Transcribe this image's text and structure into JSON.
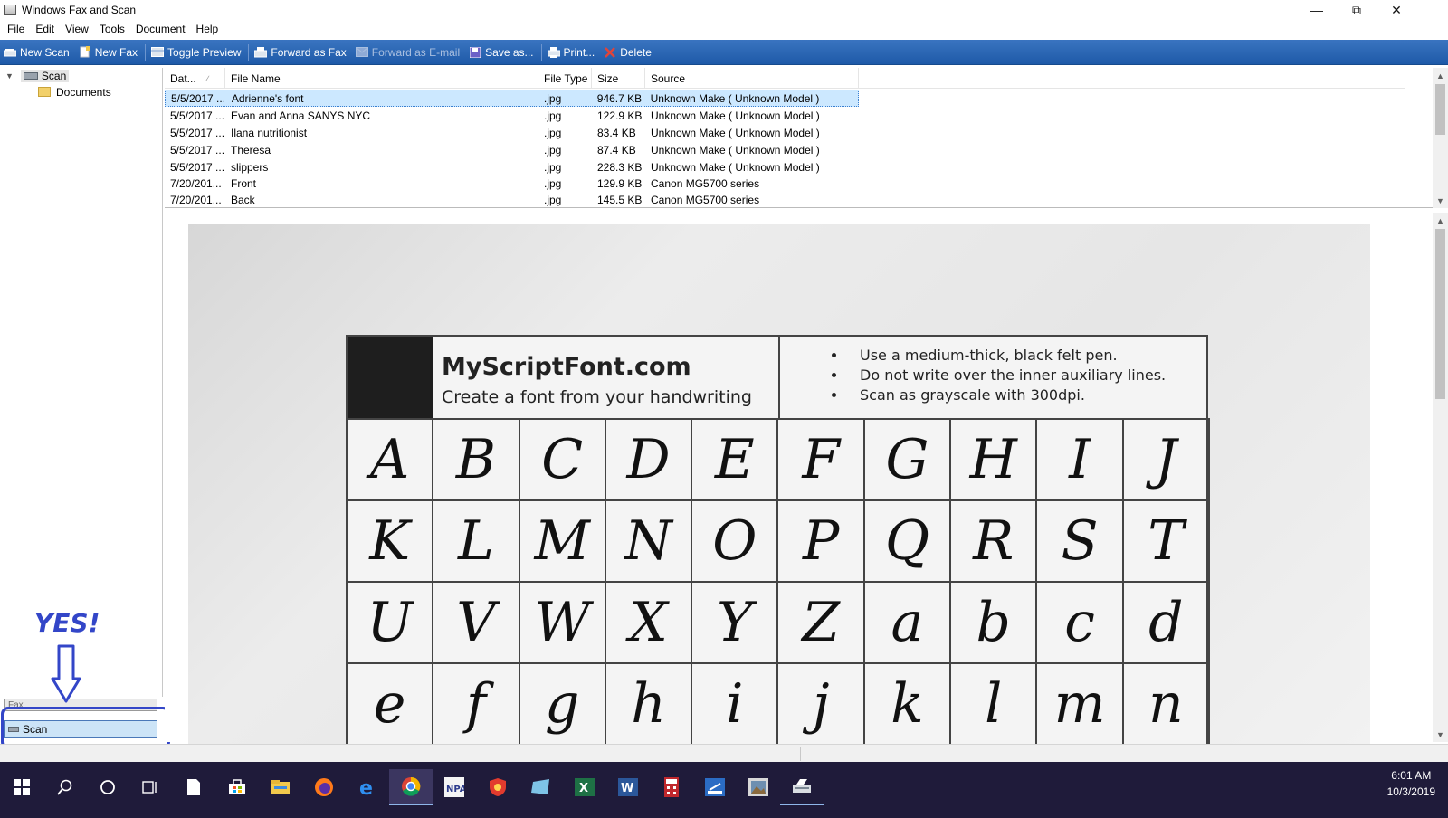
{
  "window": {
    "title": "Windows Fax and Scan"
  },
  "menu": [
    "File",
    "Edit",
    "View",
    "Tools",
    "Document",
    "Help"
  ],
  "toolbar": {
    "new_scan": "New Scan",
    "new_fax": "New Fax",
    "toggle_preview": "Toggle Preview",
    "forward_fax": "Forward as Fax",
    "forward_email": "Forward as E-mail",
    "save_as": "Save as...",
    "print": "Print...",
    "delete": "Delete"
  },
  "tree": {
    "root": "Scan",
    "child": "Documents"
  },
  "nav": {
    "fax": "Fax",
    "scan": "Scan"
  },
  "annotation": {
    "text": "YES!"
  },
  "list": {
    "headers": {
      "date": "Dat...",
      "file_name": "File Name",
      "file_type": "File Type",
      "size": "Size",
      "source": "Source"
    },
    "rows": [
      {
        "date": "5/5/2017 ...",
        "name": "Adrienne's font",
        "type": ".jpg",
        "size": "946.7 KB",
        "source": "Unknown Make ( Unknown Model )"
      },
      {
        "date": "5/5/2017 ...",
        "name": "Evan and Anna SANYS NYC",
        "type": ".jpg",
        "size": "122.9 KB",
        "source": "Unknown Make ( Unknown Model )"
      },
      {
        "date": "5/5/2017 ...",
        "name": "Ilana nutritionist",
        "type": ".jpg",
        "size": "83.4 KB",
        "source": "Unknown Make ( Unknown Model )"
      },
      {
        "date": "5/5/2017 ...",
        "name": "Theresa",
        "type": ".jpg",
        "size": "87.4 KB",
        "source": "Unknown Make ( Unknown Model )"
      },
      {
        "date": "5/5/2017 ...",
        "name": "slippers",
        "type": ".jpg",
        "size": "228.3 KB",
        "source": "Unknown Make ( Unknown Model )"
      },
      {
        "date": "7/20/201...",
        "name": "Front",
        "type": ".jpg",
        "size": "129.9 KB",
        "source": "Canon MG5700 series"
      },
      {
        "date": "7/20/201...",
        "name": "Back",
        "type": ".jpg",
        "size": "145.5 KB",
        "source": "Canon MG5700 series"
      }
    ]
  },
  "preview": {
    "brand": "MyScriptFont.com",
    "tagline": "Create a font from your handwriting",
    "instructions": [
      "Use a medium-thick, black felt pen.",
      "Do not write over the inner auxiliary lines.",
      "Scan as grayscale with 300dpi."
    ],
    "rows": [
      [
        "A",
        "B",
        "C",
        "D",
        "E",
        "F",
        "G",
        "H",
        "I",
        "J"
      ],
      [
        "K",
        "L",
        "M",
        "N",
        "O",
        "P",
        "Q",
        "R",
        "S",
        "T"
      ],
      [
        "U",
        "V",
        "W",
        "X",
        "Y",
        "Z",
        "a",
        "b",
        "c",
        "d"
      ],
      [
        "e",
        "f",
        "g",
        "h",
        "i",
        "j",
        "k",
        "l",
        "m",
        "n"
      ]
    ]
  },
  "clock": {
    "time": "6:01 AM",
    "date": "10/3/2019"
  },
  "taskbar_icons": [
    "windows-start",
    "search",
    "cortana",
    "task-view",
    "file",
    "store",
    "file-explorer",
    "firefox",
    "edge",
    "chrome",
    "npa",
    "security-app",
    "mail-app",
    "excel",
    "word",
    "calculator",
    "scanner-app",
    "photo-viewer",
    "fax-scan"
  ]
}
